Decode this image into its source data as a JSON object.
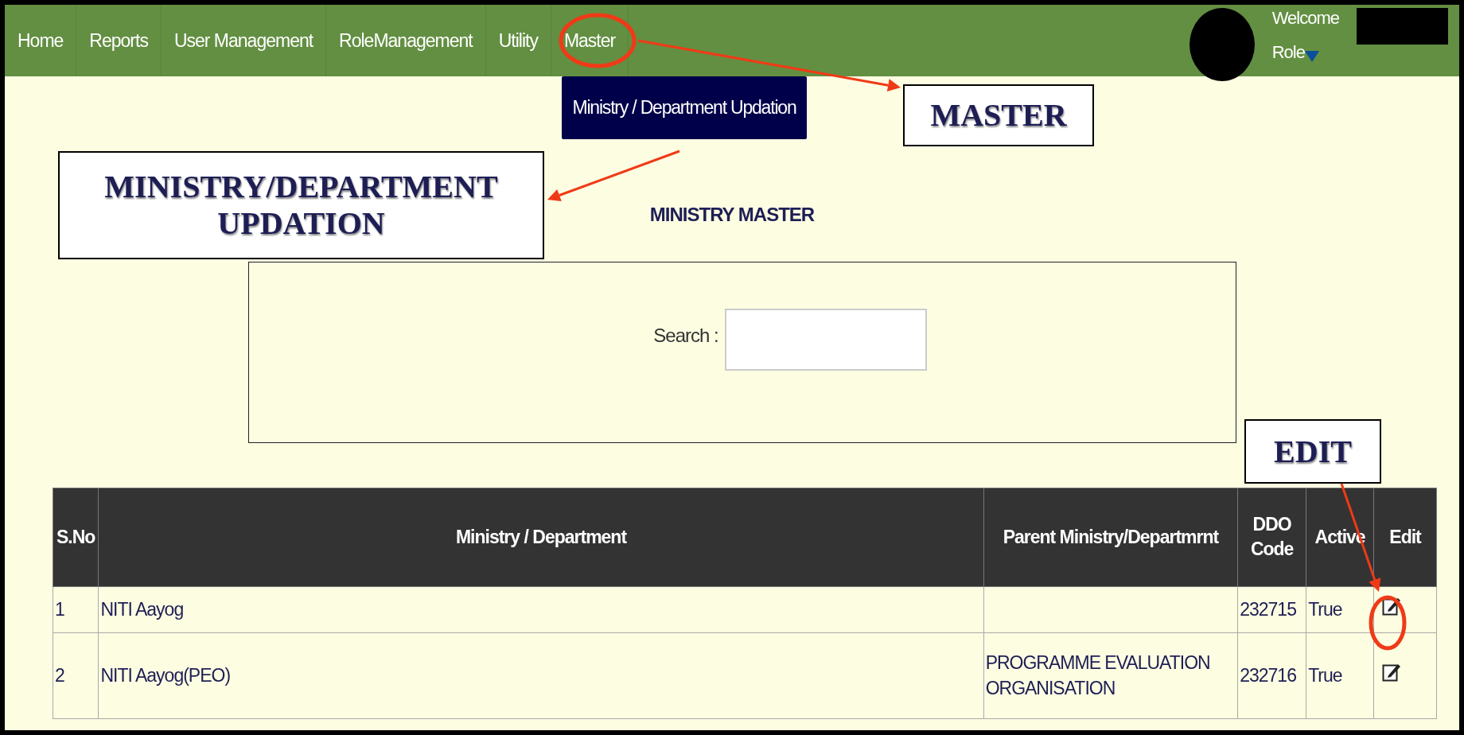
{
  "nav": {
    "items": [
      {
        "label": "Home"
      },
      {
        "label": "Reports"
      },
      {
        "label": "User Management"
      },
      {
        "label": "RoleManagement"
      },
      {
        "label": "Utility"
      },
      {
        "label": "Master"
      }
    ]
  },
  "user": {
    "greeting": "Welcome",
    "role": "Role"
  },
  "dropdown": {
    "items": [
      "Ministry / Department Updation"
    ]
  },
  "page_title": "MINISTRY MASTER",
  "search": {
    "label": "Search :"
  },
  "table": {
    "columns": [
      "S.No",
      "Ministry / Department",
      "Parent Ministry/Departmrnt",
      "DDO Code",
      "Active",
      "Edit"
    ],
    "rows": [
      {
        "s_no": "1",
        "name": "NITI Aayog",
        "parent": "",
        "ddo_code": "232715",
        "active": "True"
      },
      {
        "s_no": "2",
        "name": "NITI Aayog(PEO)",
        "parent": "PROGRAMME EVALUATION ORGANISATION",
        "ddo_code": "232716",
        "active": "True"
      }
    ]
  },
  "annotations": [
    "MASTER",
    "MINISTRY/DEPARTMENT UPDATION",
    "EDIT"
  ]
}
